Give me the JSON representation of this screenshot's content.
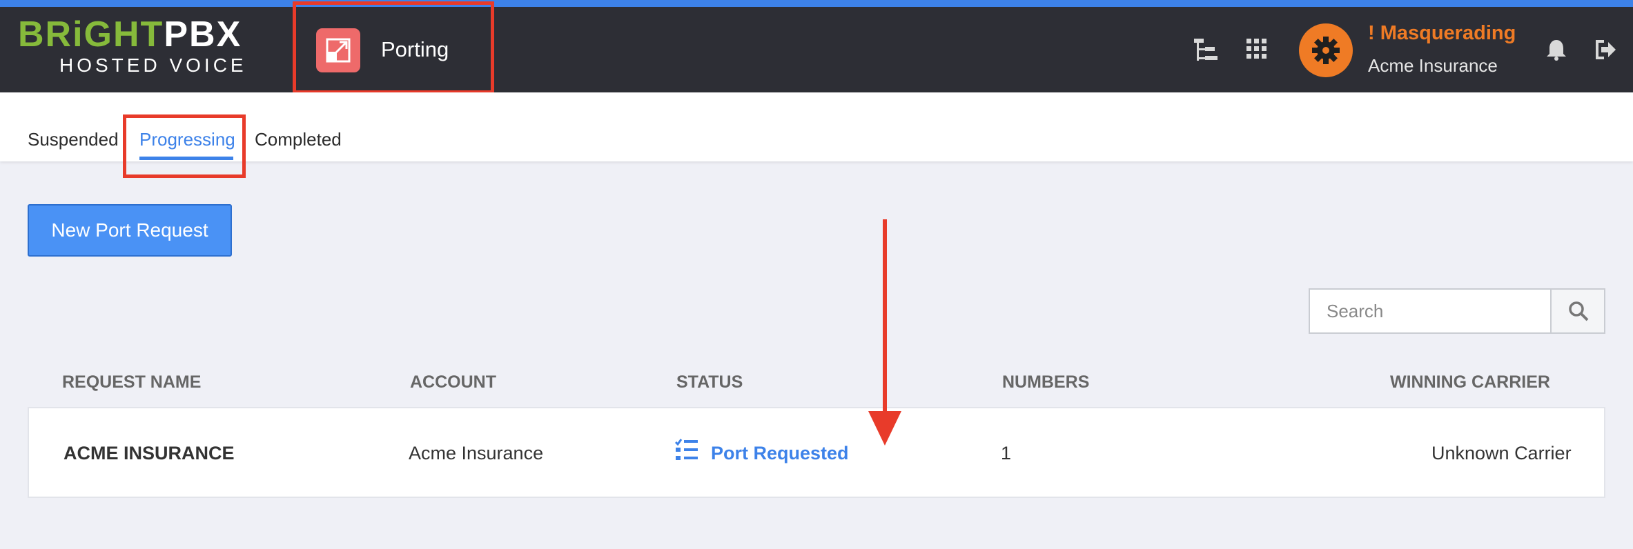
{
  "colors": {
    "accent": "#3d82e9",
    "header_bg": "#2d2e35",
    "brand_green": "#86ba3b",
    "masquerade_orange": "#ef7b25",
    "porting_icon": "#ee6a6a",
    "annotation_red": "#e83b2a"
  },
  "brand": {
    "part1": "BRiGHT",
    "part2": "PBX",
    "tagline": "HOSTED VOICE"
  },
  "app": {
    "title": "Porting",
    "icon": "porting-icon"
  },
  "header": {
    "icons": [
      "org-tree-icon",
      "app-grid-icon",
      "bell-icon",
      "logout-icon"
    ],
    "avatar_icon": "gear-icon",
    "masquerade_label": "! Masquerading",
    "account_name": "Acme Insurance"
  },
  "tabs": [
    {
      "label": "Suspended",
      "active": false
    },
    {
      "label": "Progressing",
      "active": true
    },
    {
      "label": "Completed",
      "active": false
    }
  ],
  "actions": {
    "new_port_label": "New Port Request"
  },
  "search": {
    "placeholder": "Search",
    "icon": "search-icon"
  },
  "table": {
    "columns": [
      "REQUEST NAME",
      "ACCOUNT",
      "STATUS",
      "NUMBERS",
      "WINNING CARRIER"
    ],
    "rows": [
      {
        "request_name": "ACME INSURANCE",
        "account": "Acme Insurance",
        "status": "Port Requested",
        "status_icon": "checklist-icon",
        "numbers": "1",
        "winning_carrier": "Unknown Carrier"
      }
    ]
  }
}
